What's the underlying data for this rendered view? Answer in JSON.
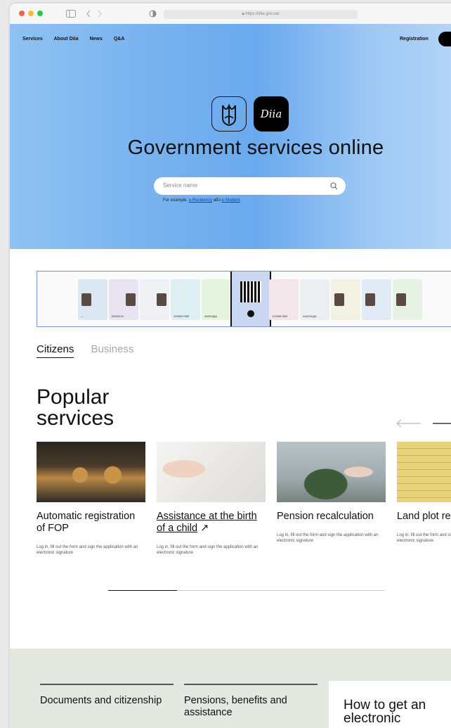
{
  "browser": {
    "url": "https://diia.gov.ua/"
  },
  "nav": {
    "items": [
      "Services",
      "About Diia",
      "News",
      "Q&A"
    ],
    "registration": "Registration"
  },
  "hero": {
    "logo_text": "Diia",
    "title": "Government services online",
    "search_placeholder": "Service name",
    "examples_prefix": "For example:",
    "example_1": "e-Residency",
    "examples_or": "або",
    "example_2": "e-Student"
  },
  "strip": {
    "card_numbers": [
      "ВН00218",
      "3005607585",
      "АМ000ДА",
      "1234567890",
      "АА0000ДА"
    ]
  },
  "tabs": {
    "active": "Citizens",
    "inactive": "Business"
  },
  "popular": {
    "title_line1": "Popular",
    "title_line2": "services",
    "items": [
      {
        "title": "Automatic registration of FOP",
        "desc": "Log in, fill out the form and sign the application with an electronic signature"
      },
      {
        "title": "Assistance at the birth of a child",
        "desc": "Log in, fill out the form and sign the application with an electronic signature"
      },
      {
        "title": "Pension recalculation",
        "desc": "Log in, fill out the form and sign the application with an electronic signature"
      },
      {
        "title": "Land plot registration",
        "desc": "Log in, fill out the form and sign the application with an electronic signature"
      }
    ]
  },
  "categories": [
    "Documents and citizenship",
    "Pensions, benefits and assistance"
  ],
  "promo": {
    "title": "How to get an electronic"
  },
  "colors": {
    "accent": "#000000",
    "hero_blue": "#6aa9ee",
    "bottom_bg": "#e3e8e0"
  }
}
